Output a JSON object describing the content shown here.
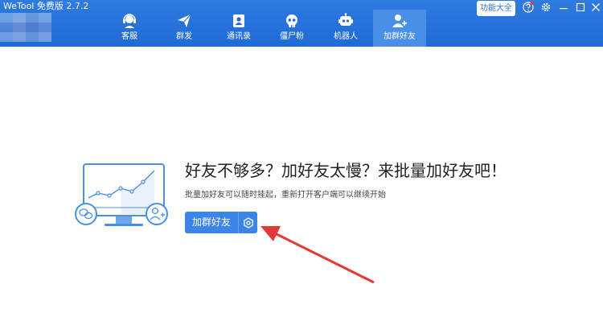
{
  "window": {
    "title": "WeTool 免费版 2.7.2"
  },
  "nav": {
    "tabs": [
      {
        "label": "客服",
        "icon": "customer-service-icon"
      },
      {
        "label": "群发",
        "icon": "paper-plane-icon"
      },
      {
        "label": "通讯录",
        "icon": "contacts-icon"
      },
      {
        "label": "僵尸粉",
        "icon": "skull-icon"
      },
      {
        "label": "机器人",
        "icon": "robot-icon"
      },
      {
        "label": "加群好友",
        "icon": "add-friend-icon"
      }
    ],
    "active_index": 5
  },
  "toolbar": {
    "feature_list_label": "功能大全"
  },
  "main": {
    "headline": "好友不够多？加好友太慢？来批量加好友吧！",
    "subtext": "批量加好友可以随时挂起，重新打开客户端可以继续开始",
    "start_button_label": "加群好友"
  },
  "colors": {
    "header": "#1f6ad6",
    "active_tab": "#4a8fe6",
    "button": "#3b84e8",
    "arrow": "#e53935"
  }
}
